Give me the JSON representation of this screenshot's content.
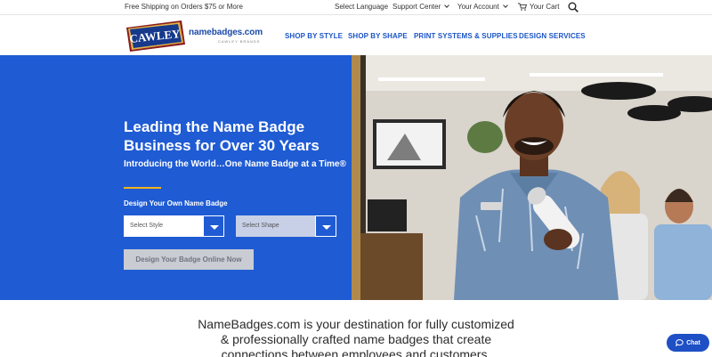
{
  "topbar": {
    "shipping": "Free Shipping on Orders $75 or More",
    "language": "Select Language",
    "support": "Support Center",
    "account": "Your Account",
    "cart": "Your Cart"
  },
  "brand": {
    "badge_text": "CAWLEY",
    "site": "namebadges.com",
    "sub": "CAWLEY BRANDS"
  },
  "nav": {
    "items": [
      {
        "label": "SHOP BY STYLE"
      },
      {
        "label": "SHOP BY SHAPE"
      },
      {
        "label": "PRINT SYSTEMS & SUPPLIES"
      },
      {
        "label": "DESIGN SERVICES"
      }
    ]
  },
  "hero": {
    "title_line1": "Leading the Name Badge",
    "title_line2": "Business for Over 30 Years",
    "subtitle": "Introducing the World…One Name Badge at a Time®",
    "design_label": "Design Your Own Name Badge",
    "style_select": {
      "selected": "Select Style"
    },
    "shape_select": {
      "selected": "Select Shape"
    },
    "cta": "Design Your Badge Online Now"
  },
  "intro": {
    "line1": "NameBadges.com is your destination for fully customized",
    "line2": "& professionally crafted name badges that create",
    "line3": "connections between employees and customers."
  },
  "chat": {
    "label": "Chat"
  },
  "colors": {
    "hero_blue": "#1f5bd3",
    "nav_blue": "#1b55c8",
    "accent_gold": "#f3b21b",
    "cta_disabled": "#c9ccd3"
  },
  "icons": [
    "chevron-down-icon",
    "cart-icon",
    "search-icon",
    "chat-bubble-icon",
    "select-arrow-icon"
  ]
}
